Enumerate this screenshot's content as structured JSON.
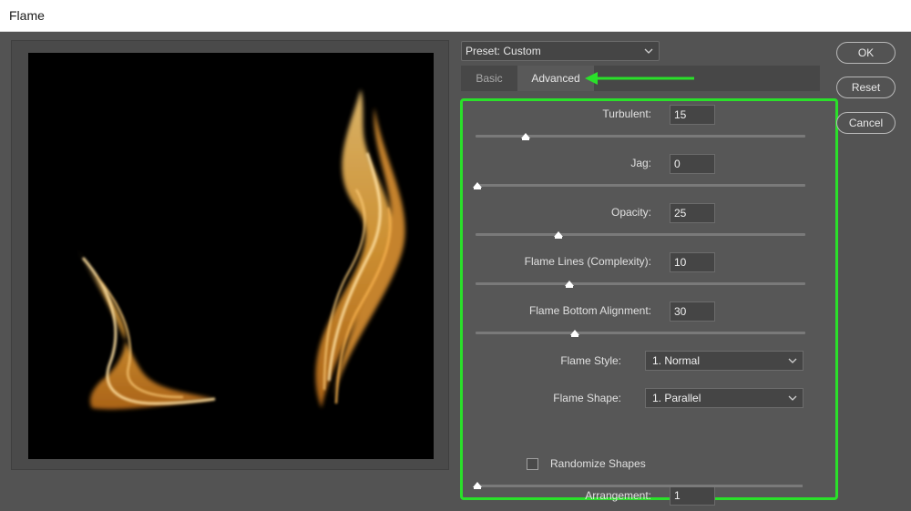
{
  "window": {
    "title": "Flame"
  },
  "preset": {
    "label": "Preset: Custom",
    "icon": "chevron-down-icon"
  },
  "tabs": [
    {
      "label": "Basic",
      "active": false
    },
    {
      "label": "Advanced",
      "active": true
    }
  ],
  "annotation": {
    "arrow_color": "#2ae02a",
    "highlight_color": "#2ae02a"
  },
  "controls": {
    "turbulent": {
      "label": "Turbulent:",
      "value": "15",
      "level": 0.15
    },
    "jag": {
      "label": "Jag:",
      "value": "0",
      "level": 0.0
    },
    "opacity": {
      "label": "Opacity:",
      "value": "25",
      "level": 0.25
    },
    "flame_lines": {
      "label": "Flame Lines (Complexity):",
      "value": "10",
      "level": 0.28
    },
    "flame_bottom_alignment": {
      "label": "Flame Bottom Alignment:",
      "value": "30",
      "level": 0.3
    },
    "flame_style": {
      "label": "Flame Style:",
      "value": "1. Normal"
    },
    "flame_shape": {
      "label": "Flame Shape:",
      "value": "1. Parallel"
    },
    "randomize_shapes": {
      "label": "Randomize Shapes",
      "checked": false
    },
    "arrangement": {
      "label": "Arrangement:",
      "value": "1",
      "level": 0.0
    }
  },
  "buttons": {
    "ok": "OK",
    "reset": "Reset",
    "cancel": "Cancel"
  }
}
